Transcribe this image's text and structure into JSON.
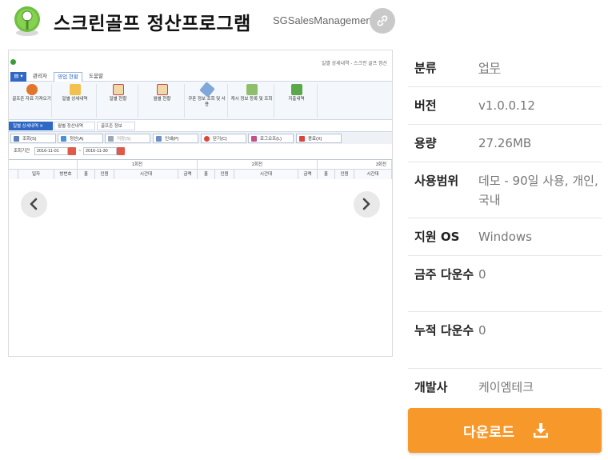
{
  "header": {
    "title": "스크린골프 정산프로그램",
    "app_id": "SGSalesManagement"
  },
  "screenshot": {
    "window_title": "일별 상세내역 - 스크린 골프 정산",
    "ribbon_tabs": [
      "관리자",
      "영업 현황",
      "도움말"
    ],
    "ribbon_buttons": [
      "골프존 자료 가져오기",
      "일별 상세내역",
      "일별 현황",
      "월별 현황",
      "쿠폰 정보 조회 및 사용",
      "캐시 정보 등록 및 조회",
      "지출내역"
    ],
    "doc_tabs": [
      "일별 상세내역",
      "월별 정산내역",
      "골프존 정보"
    ],
    "toolbar_buttons": [
      "조회(S)",
      "정산(A)",
      "저장(S)",
      "인쇄(P)",
      "닫기(C)",
      "로그오프(L)",
      "종료(X)"
    ],
    "period_label": "조회기간",
    "date_from": "2016-11-01",
    "date_to": "2016-11-30",
    "round_headers": [
      "1회전",
      "2회전",
      "3회전"
    ],
    "columns": [
      "일자",
      "방번호",
      "홀",
      "인원",
      "시간대",
      "금액",
      "홀",
      "인원",
      "시간대",
      "금액",
      "홀",
      "인원",
      "시간대"
    ]
  },
  "info": [
    {
      "key": "분류",
      "value": "업무",
      "link": true
    },
    {
      "key": "버전",
      "value": "v1.0.0.12"
    },
    {
      "key": "용량",
      "value": "27.26MB"
    },
    {
      "key": "사용범위",
      "value": "데모 - 90일 사용, 개인, 국내"
    },
    {
      "key": "지원 OS",
      "value": "Windows"
    },
    {
      "key": "금주 다운수",
      "value": "0"
    },
    {
      "key": "누적 다운수",
      "value": "0"
    },
    {
      "key": "개발사",
      "value": "케이엠테크"
    }
  ],
  "download_label": "다운로드",
  "colors": {
    "accent": "#f7992a",
    "ribbon_blue": "#2e67c4"
  }
}
